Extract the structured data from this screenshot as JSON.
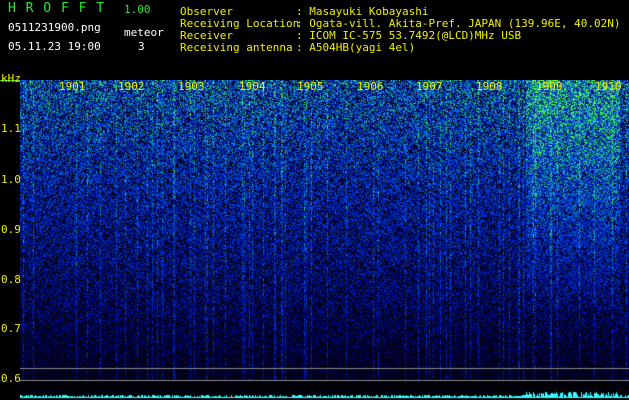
{
  "header": {
    "app_name": "H R O F F T",
    "version": "1.00",
    "filename": "0511231900.png",
    "datetime": "05.11.23 19:00",
    "meteor_label": "meteor",
    "meteor_count": "3",
    "info_labels": [
      "Observer",
      "Receiving Location",
      "Receiver",
      "Receiving antenna"
    ],
    "info_values": [
      ": Masayuki Kobayashi",
      ": Ogata-vill. Akita-Pref. JAPAN (139.96E, 40.02N)",
      ": ICOM IC-575 53.7492(@LCD)MHz USB",
      ": A504HB(yagi 4el)"
    ]
  },
  "axis": {
    "unit": "kHz",
    "freq_labels": [
      "1.1",
      "1.0",
      "0.9",
      "0.8",
      "0.7",
      "0.6"
    ],
    "time_labels": [
      "1901",
      "1902",
      "1903",
      "1904",
      "1905",
      "1906",
      "1907",
      "1908",
      "1909",
      "1910"
    ]
  },
  "colors": {
    "text_green": "#2ee62e",
    "text_yellow": "#f0f000",
    "text_white": "#ffffff",
    "background": "#000000",
    "spectrum_low": "#000a3a",
    "spectrum_mid": "#1a4cff",
    "spectrum_high": "#33ff66"
  }
}
